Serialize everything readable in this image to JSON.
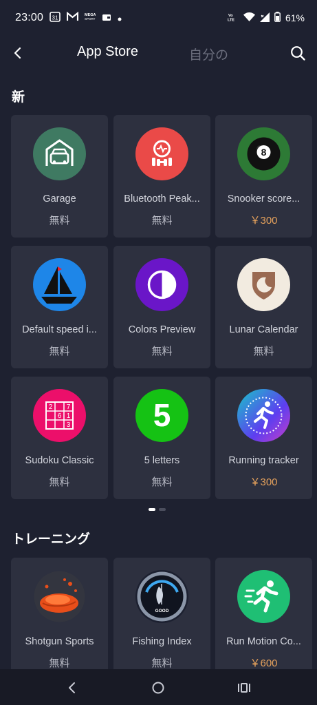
{
  "status_bar": {
    "time": "23:00",
    "calendar_day": "31",
    "notif_label": "MEGA\nSPORT",
    "network": "Vo\nLTE",
    "battery": "61%"
  },
  "header": {
    "tab_app_store": "App Store",
    "tab_mine": "自分の"
  },
  "sections": [
    {
      "title": "新",
      "apps": [
        {
          "name": "Garage",
          "price": "無料",
          "paid": false,
          "icon": "garage-icon"
        },
        {
          "name": "Bluetooth Peak...",
          "price": "無料",
          "paid": false,
          "icon": "bluetooth-peak-icon"
        },
        {
          "name": "Snooker score...",
          "price": "￥300",
          "paid": true,
          "icon": "eight-ball-icon"
        },
        {
          "name": "Default speed i...",
          "price": "無料",
          "paid": false,
          "icon": "sailboat-icon"
        },
        {
          "name": "Colors Preview",
          "price": "無料",
          "paid": false,
          "icon": "half-circle-icon"
        },
        {
          "name": "Lunar Calendar",
          "price": "無料",
          "paid": false,
          "icon": "moon-shield-icon"
        },
        {
          "name": "Sudoku Classic",
          "price": "無料",
          "paid": false,
          "icon": "sudoku-grid-icon"
        },
        {
          "name": "5 letters",
          "price": "無料",
          "paid": false,
          "icon": "five-icon"
        },
        {
          "name": "Running tracker",
          "price": "￥300",
          "paid": true,
          "icon": "runner-dial-icon"
        }
      ]
    },
    {
      "title": "トレーニング",
      "apps": [
        {
          "name": "Shotgun Sports",
          "price": "無料",
          "paid": false,
          "icon": "clay-target-icon"
        },
        {
          "name": "Fishing Index",
          "price": "無料",
          "paid": false,
          "icon": "fishing-gauge-icon"
        },
        {
          "name": "Run Motion Co...",
          "price": "￥600",
          "paid": true,
          "icon": "running-man-icon"
        }
      ]
    }
  ],
  "sudoku_digits": [
    "2",
    "7",
    "6",
    "1",
    "3"
  ],
  "gauge_label": "GOOD",
  "five_glyph": "5",
  "eight_glyph": "8",
  "pager": {
    "pages": 2,
    "current": 1
  },
  "colors": {
    "background": "#1e2130",
    "card": "#2d303f",
    "paid_price": "#e5a15c",
    "nav_bar": "#181a25"
  }
}
